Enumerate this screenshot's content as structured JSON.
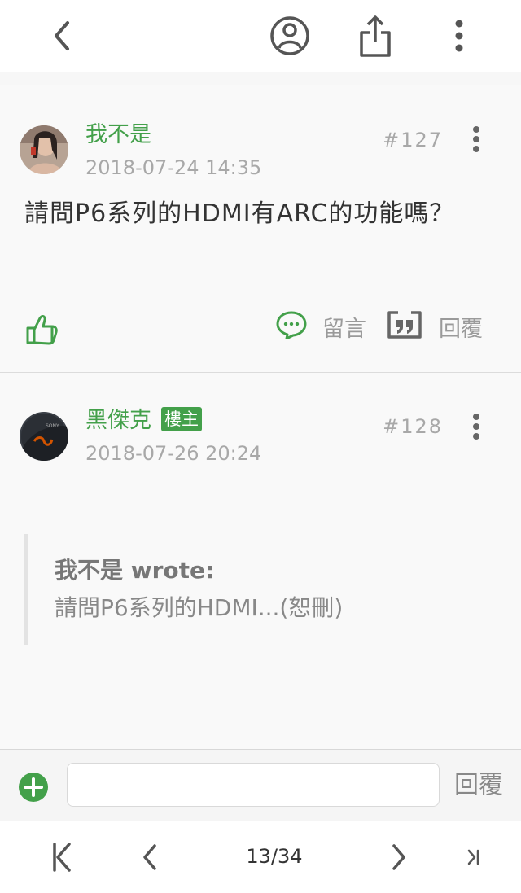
{
  "header": {
    "icons": [
      "back-arrow-icon",
      "user-circle-icon",
      "share-icon",
      "more-vertical-icon"
    ]
  },
  "posts": [
    {
      "author": "我不是",
      "time": "2018-07-24 14:35",
      "floor": "#127",
      "content": "請問P6系列的HDMI有ARC的功能嗎？",
      "actions": {
        "comment_label": "留言",
        "reply_label": "回覆"
      }
    },
    {
      "author": "黑傑克",
      "badge": "樓主",
      "time": "2018-07-26 20:24",
      "floor": "#128",
      "quote": {
        "head": "我不是 wrote:",
        "text": "請問P6系列的HDMI...(恕刪)"
      }
    }
  ],
  "reply_bar": {
    "input_value": "",
    "button_label": "回覆"
  },
  "pager": {
    "indicator": "13/34",
    "current": 13,
    "total": 34
  },
  "colors": {
    "accent": "#43a04a",
    "icon": "#555555",
    "muted": "#a8a8a8"
  }
}
